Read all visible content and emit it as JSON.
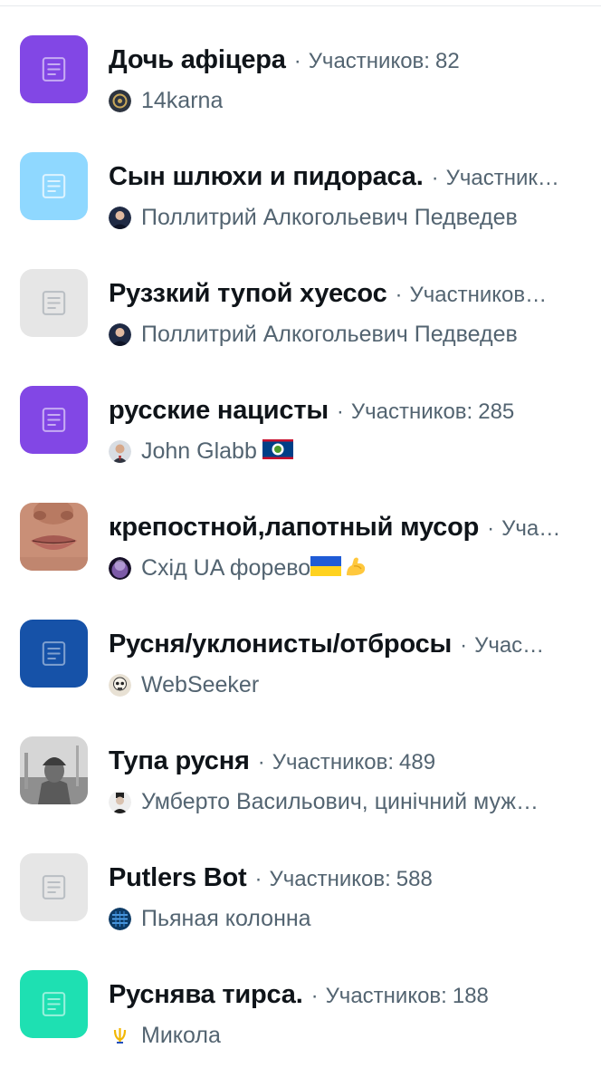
{
  "members_label": "Участников:",
  "separator": "·",
  "colors": {
    "purple": "#8247e5",
    "light_blue": "#8fd8ff",
    "gray": "#e6e6e6",
    "dark_blue": "#1652a8",
    "teal": "#1ee0b2",
    "text_secondary": "#536471"
  },
  "lists": [
    {
      "title": "Дочь афіцера",
      "members": "82",
      "thumb": "doc-purple",
      "owner": "14karna",
      "owner_avatar": "dark-ornament-avatar",
      "owner_flags": []
    },
    {
      "title": "Сын шлюхи и пидораса.",
      "members": "",
      "members_overflow": "Участник…",
      "thumb": "doc-light-blue",
      "owner": "Поллитрий Алкогольевич Педведев",
      "owner_avatar": "man-portrait-avatar",
      "owner_flags": []
    },
    {
      "title": "Руззкий тупой хуесос",
      "members": "",
      "members_overflow": "Участников…",
      "thumb": "doc-gray",
      "owner": "Поллитрий Алкогольевич Педведев",
      "owner_avatar": "man-portrait-avatar",
      "owner_flags": []
    },
    {
      "title": "русские нацисты",
      "members": "285",
      "thumb": "doc-purple",
      "owner": "John Glabb",
      "owner_avatar": "man-suit-avatar",
      "owner_flags": [
        "belize-flag"
      ]
    },
    {
      "title": "крепостной,лапотный мусор",
      "members": "",
      "members_overflow": "Уча…",
      "thumb": "lips-photo",
      "owner": "Схід UA форево",
      "owner_avatar": "purple-planet-avatar",
      "owner_flags": [
        "ukraine-flag",
        "flexed-biceps"
      ]
    },
    {
      "title": "Русня/уклонисты/отбросы",
      "members": "",
      "members_overflow": "Учас…",
      "thumb": "doc-dark-blue",
      "owner": "WebSeeker",
      "owner_avatar": "skull-avatar",
      "owner_flags": []
    },
    {
      "title": "Тупа русня",
      "members": "489",
      "thumb": "soldier-photo",
      "owner": "Умберто Васильович, цинічний муж…",
      "owner_avatar": "gentleman-avatar",
      "owner_flags": []
    },
    {
      "title": "Putlers Bot",
      "members": "588",
      "thumb": "doc-gray",
      "owner": "Пьяная колонна",
      "owner_avatar": "blue-pattern-avatar",
      "owner_flags": []
    },
    {
      "title": "Руснява тирса.",
      "members": "188",
      "thumb": "doc-teal",
      "owner": "Микола",
      "owner_avatar": "trident-avatar",
      "owner_flags": []
    }
  ]
}
